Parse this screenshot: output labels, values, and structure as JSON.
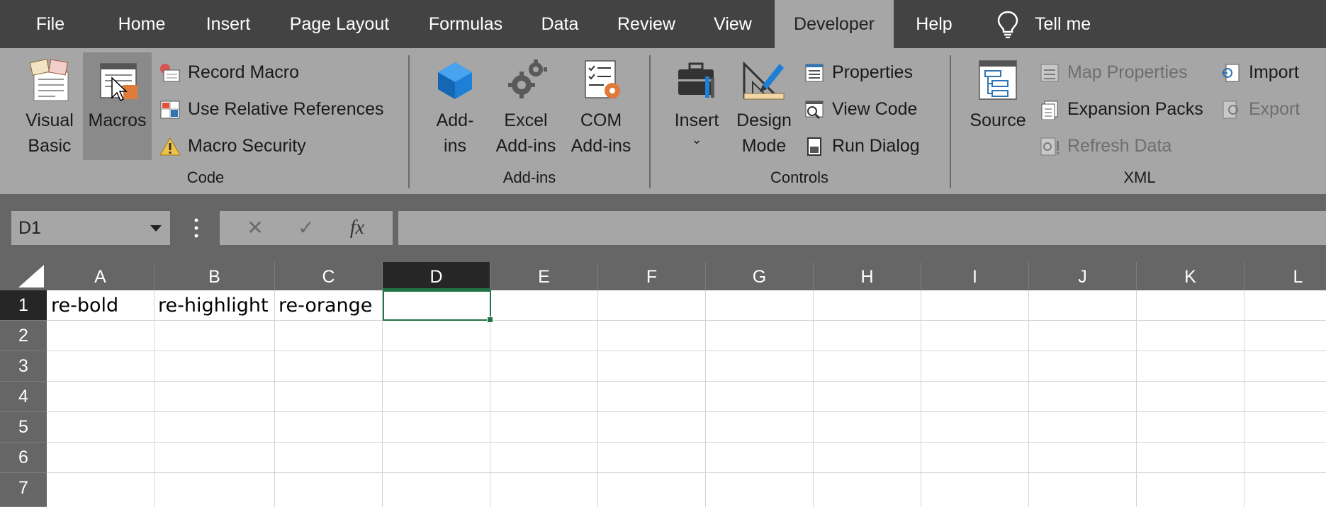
{
  "tabs": [
    {
      "label": "File"
    },
    {
      "label": "Home"
    },
    {
      "label": "Insert"
    },
    {
      "label": "Page Layout"
    },
    {
      "label": "Formulas"
    },
    {
      "label": "Data"
    },
    {
      "label": "Review"
    },
    {
      "label": "View"
    },
    {
      "label": "Developer"
    },
    {
      "label": "Help"
    }
  ],
  "active_tab": "Developer",
  "tell_me": "Tell me",
  "ribbon": {
    "code": {
      "group_label": "Code",
      "visual_basic": "Visual\nBasic",
      "macros": "Macros",
      "record_macro": "Record Macro",
      "use_relative": "Use Relative References",
      "macro_security": "Macro Security"
    },
    "addins": {
      "group_label": "Add-ins",
      "addins": "Add-\nins",
      "excel_addins": "Excel\nAdd-ins",
      "com_addins": "COM\nAdd-ins"
    },
    "controls": {
      "group_label": "Controls",
      "insert": "Insert",
      "design_mode": "Design\nMode",
      "properties": "Properties",
      "view_code": "View Code",
      "run_dialog": "Run Dialog"
    },
    "xml": {
      "group_label": "XML",
      "source": "Source",
      "map_properties": "Map Properties",
      "expansion_packs": "Expansion Packs",
      "refresh_data": "Refresh Data",
      "import": "Import",
      "export": "Export"
    }
  },
  "formula_bar": {
    "name_box": "D1",
    "cancel_glyph": "✕",
    "enter_glyph": "✓",
    "fx_glyph": "fx",
    "formula": ""
  },
  "sheet": {
    "columns": [
      "A",
      "B",
      "C",
      "D",
      "E",
      "F",
      "G",
      "H",
      "I",
      "J",
      "K",
      "L"
    ],
    "rows": [
      "1",
      "2",
      "3",
      "4",
      "5",
      "6",
      "7"
    ],
    "selected_column": "D",
    "selected_row": "1",
    "cells": {
      "A1": "re-bold",
      "B1": "re-highlight",
      "C1": "re-orange"
    }
  },
  "colors": {
    "tabbar_bg": "#434343",
    "ribbon_bg": "#a6a6a6",
    "accent_green": "#217346",
    "addin_blue": "#1e7fd6",
    "gear_orange": "#e07b39"
  }
}
